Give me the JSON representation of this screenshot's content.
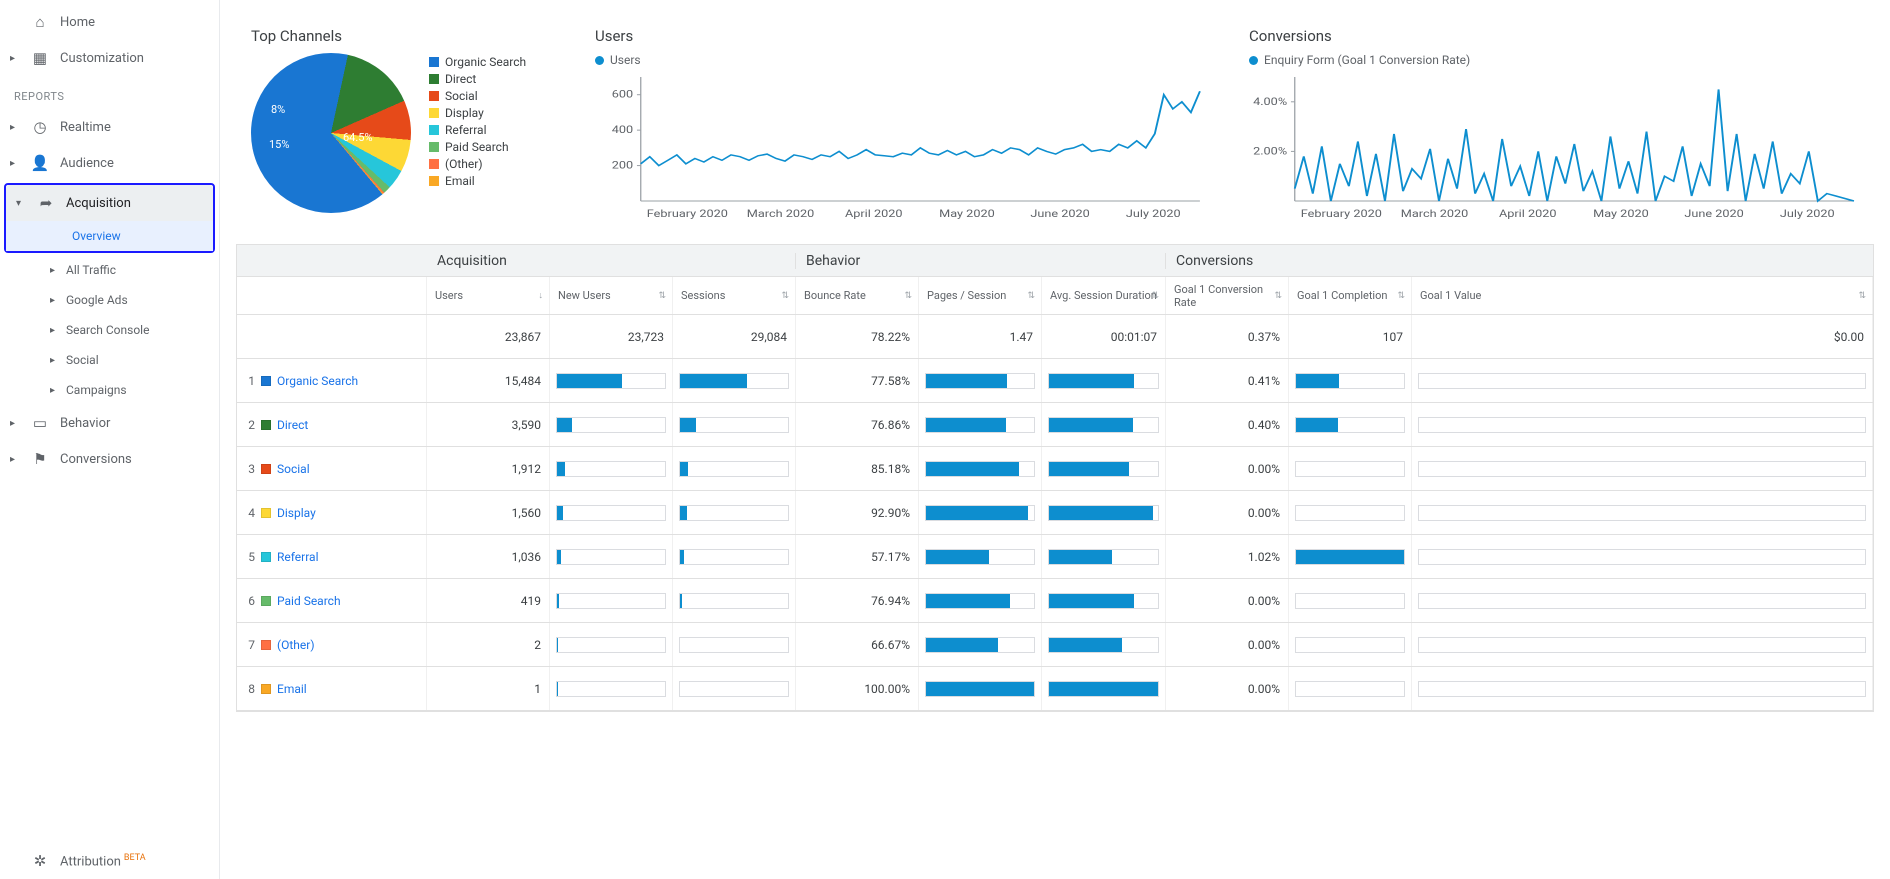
{
  "sidebar": {
    "home": "Home",
    "customization": "Customization",
    "reports_label": "REPORTS",
    "realtime": "Realtime",
    "audience": "Audience",
    "acquisition": "Acquisition",
    "acquisition_sub": {
      "overview": "Overview",
      "all_traffic": "All Traffic",
      "google_ads": "Google Ads",
      "search_console": "Search Console",
      "social": "Social",
      "campaigns": "Campaigns"
    },
    "behavior": "Behavior",
    "conversions": "Conversions",
    "attribution": "Attribution",
    "beta": "BETA"
  },
  "cards": {
    "top_channels": {
      "title": "Top Channels"
    },
    "users": {
      "title": "Users",
      "legend": "Users"
    },
    "conversions": {
      "title": "Conversions",
      "legend": "Enquiry Form (Goal 1 Conversion Rate)"
    }
  },
  "colors": {
    "organic": "#1976d2",
    "direct": "#2e7d32",
    "social": "#e64a19",
    "display": "#fdd835",
    "referral": "#26c6da",
    "paid": "#66bb6a",
    "other": "#ff7043",
    "email": "#f9a825",
    "bar": "#0d8ecf"
  },
  "pie_labels": {
    "organic": "64.5%",
    "direct": "15%",
    "social": "8%"
  },
  "legend_items": [
    {
      "label": "Organic Search",
      "color": "#1976d2"
    },
    {
      "label": "Direct",
      "color": "#2e7d32"
    },
    {
      "label": "Social",
      "color": "#e64a19"
    },
    {
      "label": "Display",
      "color": "#fdd835"
    },
    {
      "label": "Referral",
      "color": "#26c6da"
    },
    {
      "label": "Paid Search",
      "color": "#66bb6a"
    },
    {
      "label": "(Other)",
      "color": "#ff7043"
    },
    {
      "label": "Email",
      "color": "#f9a825"
    }
  ],
  "months": [
    "February 2020",
    "March 2020",
    "April 2020",
    "May 2020",
    "June 2020",
    "July 2020"
  ],
  "table": {
    "groups": {
      "acquisition": "Acquisition",
      "behavior": "Behavior",
      "conversions": "Conversions"
    },
    "cols": {
      "users": "Users",
      "new_users": "New Users",
      "sessions": "Sessions",
      "bounce": "Bounce Rate",
      "pps": "Pages / Session",
      "dur": "Avg. Session Duration",
      "gcr": "Goal 1 Conversion Rate",
      "gcomp": "Goal 1 Completion",
      "gval": "Goal 1 Value"
    },
    "totals": {
      "users": "23,867",
      "new_users": "23,723",
      "sessions": "29,084",
      "bounce": "78.22%",
      "pps": "1.47",
      "dur": "00:01:07",
      "gcr": "0.37%",
      "gcomp": "107",
      "gval": "$0.00"
    },
    "rows": [
      {
        "idx": 1,
        "name": "Organic Search",
        "color": "#1976d2",
        "users": "15,484",
        "users_n": 15484,
        "new_bar": 0.6,
        "bounce": "77.58%",
        "pps_bar": 0.75,
        "dur_bar": 0.78,
        "gcr": "0.41%",
        "gcomp_bar": 0.4,
        "gval_bar": 0
      },
      {
        "idx": 2,
        "name": "Direct",
        "color": "#2e7d32",
        "users": "3,590",
        "users_n": 3590,
        "new_bar": 0.14,
        "bounce": "76.86%",
        "pps_bar": 0.74,
        "dur_bar": 0.77,
        "gcr": "0.40%",
        "gcomp_bar": 0.39,
        "gval_bar": 0
      },
      {
        "idx": 3,
        "name": "Social",
        "color": "#e64a19",
        "users": "1,912",
        "users_n": 1912,
        "new_bar": 0.07,
        "bounce": "85.18%",
        "pps_bar": 0.86,
        "dur_bar": 0.73,
        "gcr": "0.00%",
        "gcomp_bar": 0,
        "gval_bar": 0
      },
      {
        "idx": 4,
        "name": "Display",
        "color": "#fdd835",
        "users": "1,560",
        "users_n": 1560,
        "new_bar": 0.06,
        "bounce": "92.90%",
        "pps_bar": 0.94,
        "dur_bar": 0.95,
        "gcr": "0.00%",
        "gcomp_bar": 0,
        "gval_bar": 0
      },
      {
        "idx": 5,
        "name": "Referral",
        "color": "#26c6da",
        "users": "1,036",
        "users_n": 1036,
        "new_bar": 0.04,
        "bounce": "57.17%",
        "pps_bar": 0.58,
        "dur_bar": 0.58,
        "gcr": "1.02%",
        "gcomp_bar": 1.0,
        "gval_bar": 0
      },
      {
        "idx": 6,
        "name": "Paid Search",
        "color": "#66bb6a",
        "users": "419",
        "users_n": 419,
        "new_bar": 0.02,
        "bounce": "76.94%",
        "pps_bar": 0.78,
        "dur_bar": 0.78,
        "gcr": "0.00%",
        "gcomp_bar": 0,
        "gval_bar": 0
      },
      {
        "idx": 7,
        "name": "(Other)",
        "color": "#ff7043",
        "users": "2",
        "users_n": 2,
        "new_bar": 0.005,
        "bounce": "66.67%",
        "pps_bar": 0.67,
        "dur_bar": 0.67,
        "gcr": "0.00%",
        "gcomp_bar": 0,
        "gval_bar": 0
      },
      {
        "idx": 8,
        "name": "Email",
        "color": "#f9a825",
        "users": "1",
        "users_n": 1,
        "new_bar": 0.003,
        "bounce": "100.00%",
        "pps_bar": 1.0,
        "dur_bar": 1.0,
        "gcr": "0.00%",
        "gcomp_bar": 0,
        "gval_bar": 0
      }
    ]
  },
  "chart_data": [
    {
      "type": "pie",
      "title": "Top Channels",
      "series": [
        {
          "name": "Organic Search",
          "value": 64.5,
          "color": "#1976d2"
        },
        {
          "name": "Direct",
          "value": 15.0,
          "color": "#2e7d32"
        },
        {
          "name": "Social",
          "value": 8.0,
          "color": "#e64a19"
        },
        {
          "name": "Display",
          "value": 6.5,
          "color": "#fdd835"
        },
        {
          "name": "Referral",
          "value": 4.0,
          "color": "#26c6da"
        },
        {
          "name": "Paid Search",
          "value": 1.5,
          "color": "#66bb6a"
        },
        {
          "name": "(Other)",
          "value": 0.3,
          "color": "#ff7043"
        },
        {
          "name": "Email",
          "value": 0.2,
          "color": "#f9a825"
        }
      ]
    },
    {
      "type": "line",
      "title": "Users",
      "xlabel": "",
      "ylabel": "",
      "yticks": [
        200,
        400,
        600
      ],
      "xticks": [
        "February 2020",
        "March 2020",
        "April 2020",
        "May 2020",
        "June 2020",
        "July 2020"
      ],
      "series": [
        {
          "name": "Users",
          "color": "#0d8ecf",
          "values": [
            210,
            250,
            200,
            230,
            260,
            210,
            240,
            220,
            250,
            230,
            260,
            250,
            230,
            255,
            265,
            240,
            225,
            260,
            250,
            235,
            260,
            250,
            280,
            240,
            260,
            290,
            260,
            255,
            250,
            270,
            260,
            300,
            270,
            260,
            285,
            260,
            280,
            250,
            260,
            290,
            270,
            300,
            290,
            260,
            300,
            280,
            265,
            290,
            300,
            320,
            280,
            290,
            280,
            320,
            300,
            340,
            300,
            380,
            600,
            520,
            560,
            500,
            620
          ]
        }
      ]
    },
    {
      "type": "line",
      "title": "Conversions",
      "legend": "Enquiry Form (Goal 1 Conversion Rate)",
      "xlabel": "",
      "ylabel": "",
      "yticks": [
        "2.00%",
        "4.00%"
      ],
      "xticks": [
        "February 2020",
        "March 2020",
        "April 2020",
        "May 2020",
        "June 2020",
        "July 2020"
      ],
      "series": [
        {
          "name": "Enquiry Form (Goal 1 Conversion Rate)",
          "color": "#0d8ecf",
          "values_pct": [
            0.5,
            1.8,
            0.3,
            2.2,
            0.0,
            1.5,
            0.6,
            2.4,
            0.2,
            1.9,
            0.0,
            2.7,
            0.4,
            1.3,
            0.9,
            2.1,
            0.0,
            1.7,
            0.5,
            2.9,
            0.3,
            1.1,
            0.0,
            2.5,
            0.6,
            1.4,
            0.2,
            2.0,
            0.0,
            1.8,
            0.7,
            2.3,
            0.4,
            1.2,
            0.0,
            2.6,
            0.5,
            1.6,
            0.3,
            2.8,
            0.0,
            1.0,
            0.8,
            2.2,
            0.2,
            1.5,
            0.6,
            4.5,
            0.4,
            2.7,
            0.0,
            1.9,
            0.5,
            2.4,
            0.3,
            1.1,
            0.7,
            2.0,
            0.0,
            0.3,
            0.2,
            0.1,
            0.0
          ]
        }
      ]
    }
  ]
}
